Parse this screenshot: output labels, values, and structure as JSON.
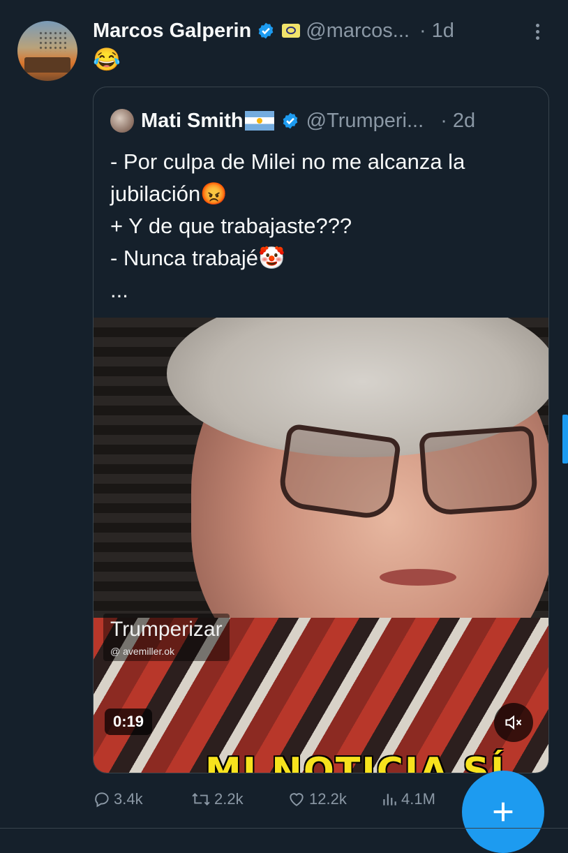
{
  "tweet": {
    "author_name": "Marcos Galperin",
    "handle": "@marcos...",
    "time": "· 1d",
    "text": "😂",
    "verified_icon": "verified-badge-icon",
    "affiliate_icon": "mercadolibre-badge-icon"
  },
  "quote": {
    "author_name": "Mati Smith🇦🇷",
    "author_name_text": "Mati Smith",
    "handle": "@Trumperi...",
    "time": "· 2d",
    "body": "- Por culpa de Milei no me alcanza la jubilación😡\n+ Y de que trabajaste???\n- Nunca trabajé🤡\n...",
    "media": {
      "watermark": "Trumperizar",
      "watermark_sub": "@ avemiller.ok",
      "caption": "MI NOTICIA SÍ",
      "duration": "0:19",
      "mute_icon": "muted-speaker-icon"
    }
  },
  "actions": {
    "replies": "3.4k",
    "reposts": "2.2k",
    "likes": "12.2k",
    "views": "4.1M"
  },
  "colors": {
    "background": "#15202b",
    "accent": "#1d9bf0",
    "muted_text": "#8b98a5",
    "border": "#38444d"
  },
  "fab_icon": "plus-icon"
}
